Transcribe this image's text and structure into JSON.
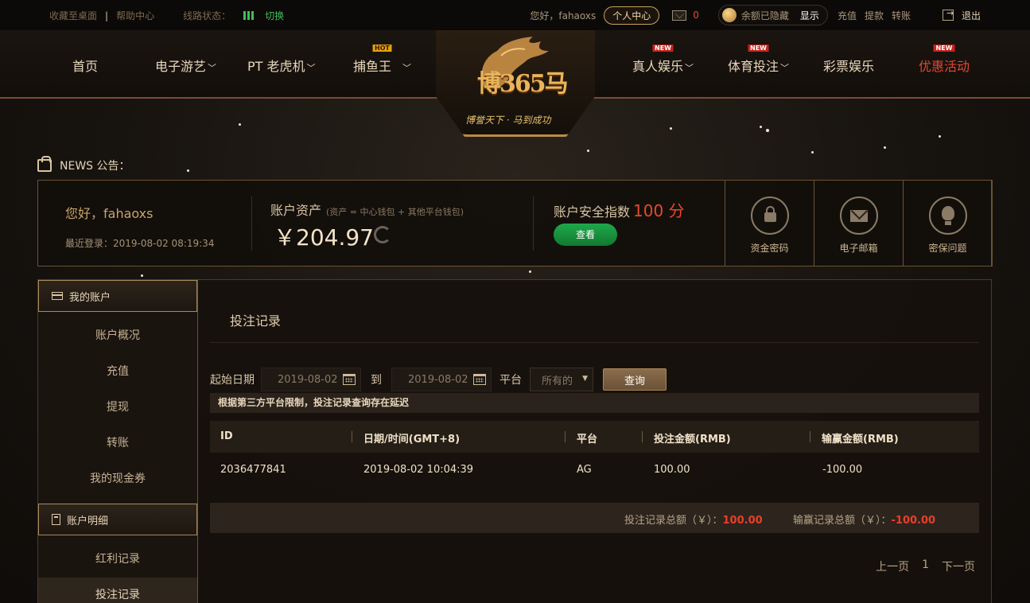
{
  "topbar": {
    "bookmark": "收藏至桌面",
    "help": "帮助中心",
    "line_status_label": "线路状态：",
    "switch": "切换",
    "greeting": "您好，fahaoxs",
    "personal_center": "个人中心",
    "mail_count": "0",
    "balance_hidden": "余额已隐藏",
    "show": "显示",
    "deposit": "充值",
    "withdraw": "提款",
    "transfer": "转账",
    "logout": "退出"
  },
  "nav": {
    "items": [
      {
        "label": "首页"
      },
      {
        "label": "电子游艺"
      },
      {
        "label": "PT 老虎机"
      },
      {
        "label": "捕鱼王",
        "badge": "HOT"
      },
      {
        "label": "真人娱乐",
        "badge": "NEW"
      },
      {
        "label": "体育投注",
        "badge": "NEW"
      },
      {
        "label": "彩票娱乐"
      },
      {
        "label": "优惠活动",
        "badge": "NEW"
      }
    ]
  },
  "logo": {
    "brand": "博365马",
    "slogan": "博誉天下 · 马到成功"
  },
  "news": {
    "label": "NEWS 公告："
  },
  "summary": {
    "hello": "您好，fahaoxs",
    "last_login": "最近登录：2019-08-02 08:19:34",
    "assets_label": "账户资产",
    "assets_note": "(资产 = 中心钱包 + 其他平台钱包)",
    "assets_value": "￥204.97",
    "security_label": "账户安全指数",
    "security_score": "100 分",
    "view_button": "查看",
    "security_items": [
      "资金密码",
      "电子邮箱",
      "密保问题"
    ]
  },
  "sidebar": {
    "group1_title": "我的账户",
    "group1_items": [
      "账户概况",
      "充值",
      "提现",
      "转账",
      "我的现金券"
    ],
    "group2_title": "账户明细",
    "group2_items": [
      "红利记录",
      "投注记录"
    ]
  },
  "panel": {
    "title": "投注记录",
    "start_date_label": "起始日期",
    "start_date": "2019-08-02",
    "to_label": "到",
    "end_date": "2019-08-02",
    "platform_label": "平台",
    "platform_value": "所有的",
    "query_button": "查询",
    "notice": "根据第三方平台限制，投注记录查询存在延迟",
    "columns": [
      "ID",
      "日期/时间(GMT+8)",
      "平台",
      "投注金额(RMB)",
      "输赢金额(RMB)"
    ],
    "rows": [
      [
        "2036477841",
        "2019-08-02 10:04:39",
        "AG",
        "100.00",
        "-100.00"
      ]
    ],
    "bet_total_label": "投注记录总额（￥）：",
    "bet_total": "100.00",
    "win_total_label": "输赢记录总额（￥）：",
    "win_total": "-100.00",
    "pager": {
      "prev": "上一页",
      "page": "1",
      "next": "下一页"
    }
  }
}
